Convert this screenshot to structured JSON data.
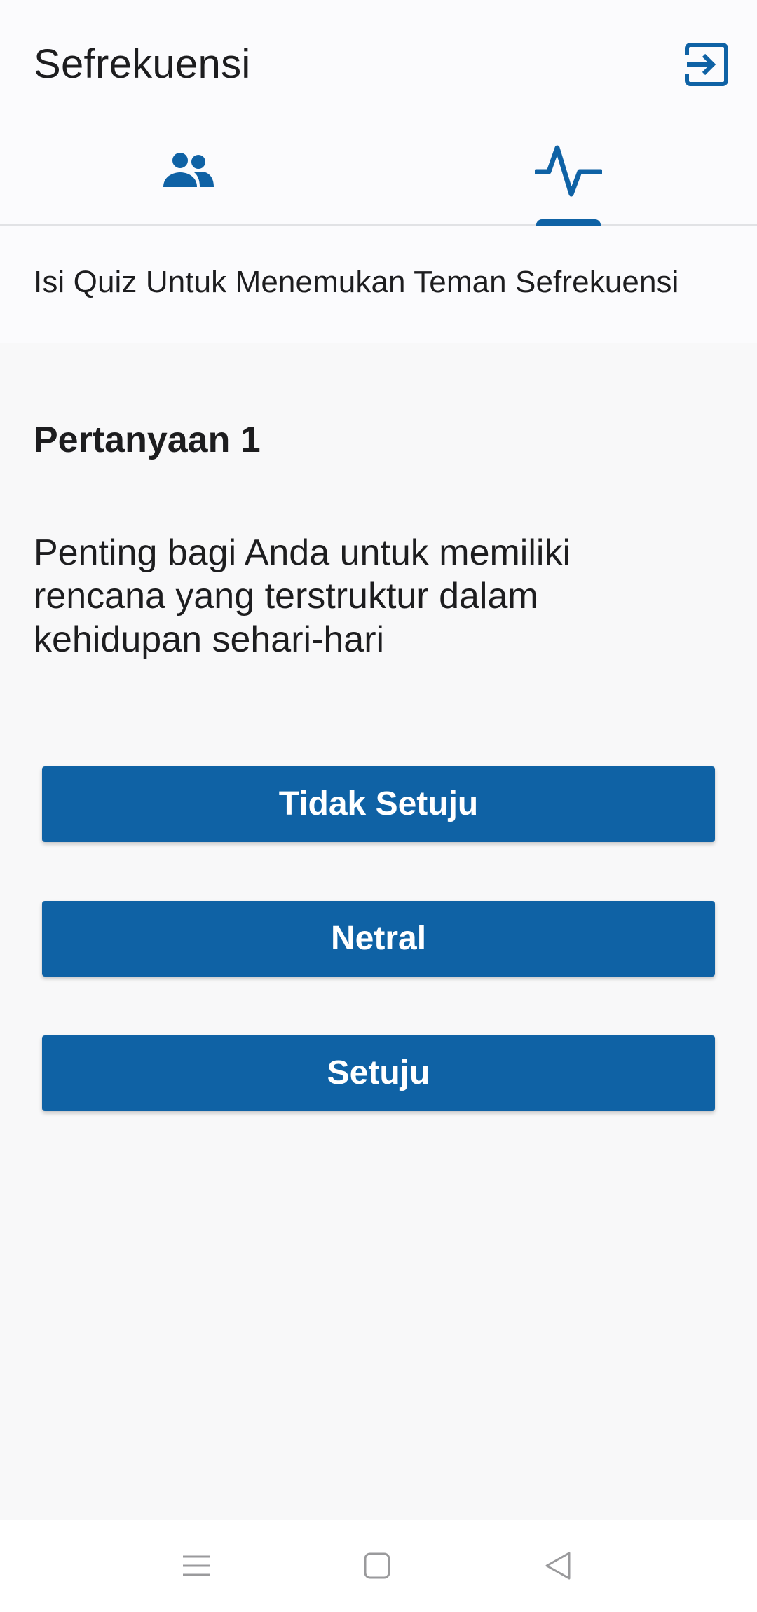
{
  "app": {
    "title": "Sefrekuensi",
    "accent_color": "#0f62a5"
  },
  "header": {
    "logout_icon": "logout-icon"
  },
  "tabs": [
    {
      "icon": "people-icon",
      "selected": false
    },
    {
      "icon": "pulse-icon",
      "selected": true
    }
  ],
  "subtitle": "Isi Quiz Untuk Menemukan Teman Sefrekuensi",
  "question": {
    "number_label": "Pertanyaan 1",
    "text": "Penting bagi Anda untuk memiliki rencana yang terstruktur dalam kehidupan sehari-hari"
  },
  "answers": [
    {
      "label": "Tidak Setuju"
    },
    {
      "label": "Netral"
    },
    {
      "label": "Setuju"
    }
  ],
  "navbar": {
    "menu_icon": "menu-icon",
    "home_icon": "home-square-icon",
    "back_icon": "back-triangle-icon"
  }
}
